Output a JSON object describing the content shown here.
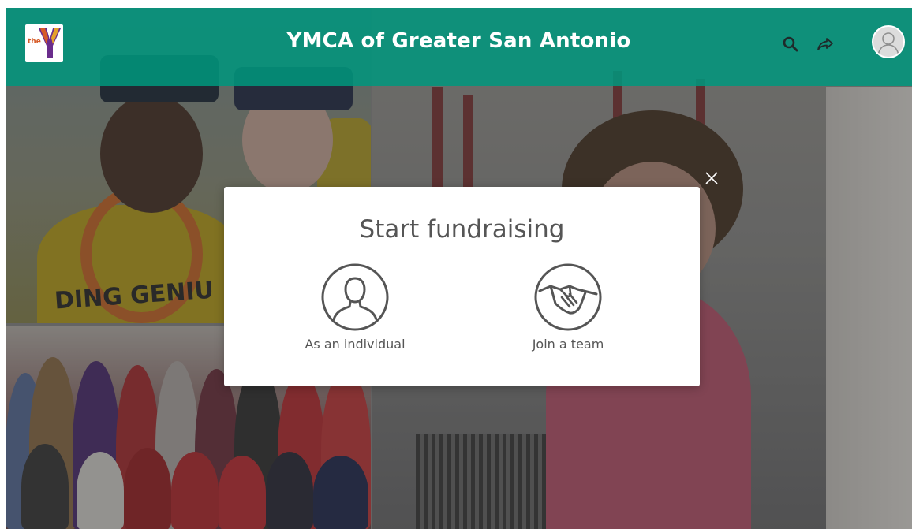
{
  "header": {
    "logo_text": "the",
    "site_title": "YMCA of Greater San Antonio",
    "icons": [
      "search-icon",
      "share-icon",
      "user-avatar-icon"
    ]
  },
  "modal": {
    "title": "Start fundraising",
    "options": [
      {
        "label": "As an individual",
        "icon": "person-icon"
      },
      {
        "label": "Join a team",
        "icon": "handshake-icon"
      }
    ],
    "close_icon": "close-icon"
  },
  "background": {
    "shirt_text": "DING GENIU",
    "photos": [
      "kids-graduation-photo",
      "senior-group-photo",
      "girl-playground-photo"
    ]
  },
  "colors": {
    "header_teal": "#00967D",
    "logo_purple": "#6a2c8c",
    "logo_orange": "#d65b28",
    "text_gray": "#555555",
    "modal_bg": "#ffffff"
  }
}
